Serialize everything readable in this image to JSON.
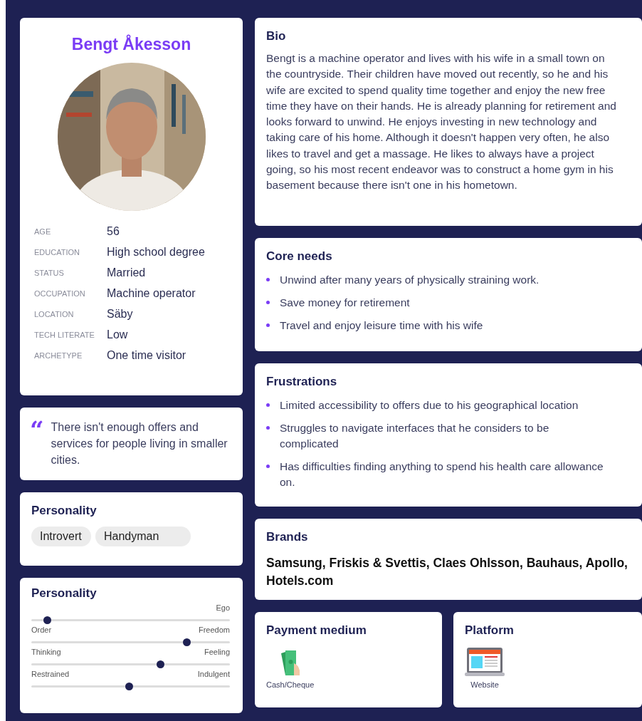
{
  "profile": {
    "name": "Bengt Åkesson",
    "facts": [
      {
        "label": "AGE",
        "value": "56"
      },
      {
        "label": "EDUCATION",
        "value": "High school degree"
      },
      {
        "label": "STATUS",
        "value": "Married"
      },
      {
        "label": "OCCUPATION",
        "value": "Machine operator"
      },
      {
        "label": "LOCATION",
        "value": "Säby"
      },
      {
        "label": "TECH LITERATE",
        "value": "Low"
      },
      {
        "label": "ARCHETYPE",
        "value": "One time visitor"
      }
    ]
  },
  "quote": {
    "mark": "“",
    "text": "There isn't enough offers and services for people living in smaller cities."
  },
  "personality_tags": {
    "title": "Personality",
    "tags": [
      "Introvert",
      "Handyman"
    ]
  },
  "personality_scales": {
    "title": "Personality",
    "scales": [
      {
        "right": "Ego",
        "level": 0.08
      },
      {
        "left": "Order",
        "right": "Freedom",
        "level": 0.78
      },
      {
        "left": "Thinking",
        "right": "Feeling",
        "level": 0.65
      },
      {
        "left": "Restrained",
        "right": "Indulgent",
        "level": 0.49
      }
    ]
  },
  "bio": {
    "title": "Bio",
    "text": "Bengt is a machine operator and lives with his wife in a small town on the countryside. Their children have moved out recently, so he and his wife are excited to spend quality time together and enjoy the new free time they have on their hands. He is already planning for retirement and looks forward to unwind. He enjoys investing in new technology and taking care of his home. Although it doesn't happen very often, he also likes to travel and get a massage. He likes to always have a project going, so his most recent endeavor was to construct a home gym in his basement because there isn't one in his hometown."
  },
  "core_needs": {
    "title": "Core needs",
    "items": [
      "Unwind after many years of physically straining work.",
      "Save money for retirement",
      "Travel and enjoy leisure time with his wife"
    ]
  },
  "frustrations": {
    "title": "Frustrations",
    "items": [
      "Limited accessibility to offers due to his geographical location",
      "Struggles to navigate interfaces that he considers to be complicated",
      "Has difficulties finding anything to spend his health care allowance on."
    ]
  },
  "brands": {
    "title": "Brands",
    "text": "Samsung, Friskis & Svettis, Claes Ohlsson, Bauhaus, Apollo, Hotels.com"
  },
  "payment_medium": {
    "title": "Payment medium",
    "items": [
      {
        "kind": "cash",
        "label": "Cash/Cheque"
      }
    ]
  },
  "platform": {
    "title": "Platform",
    "items": [
      {
        "kind": "website",
        "label": "Website"
      }
    ]
  }
}
